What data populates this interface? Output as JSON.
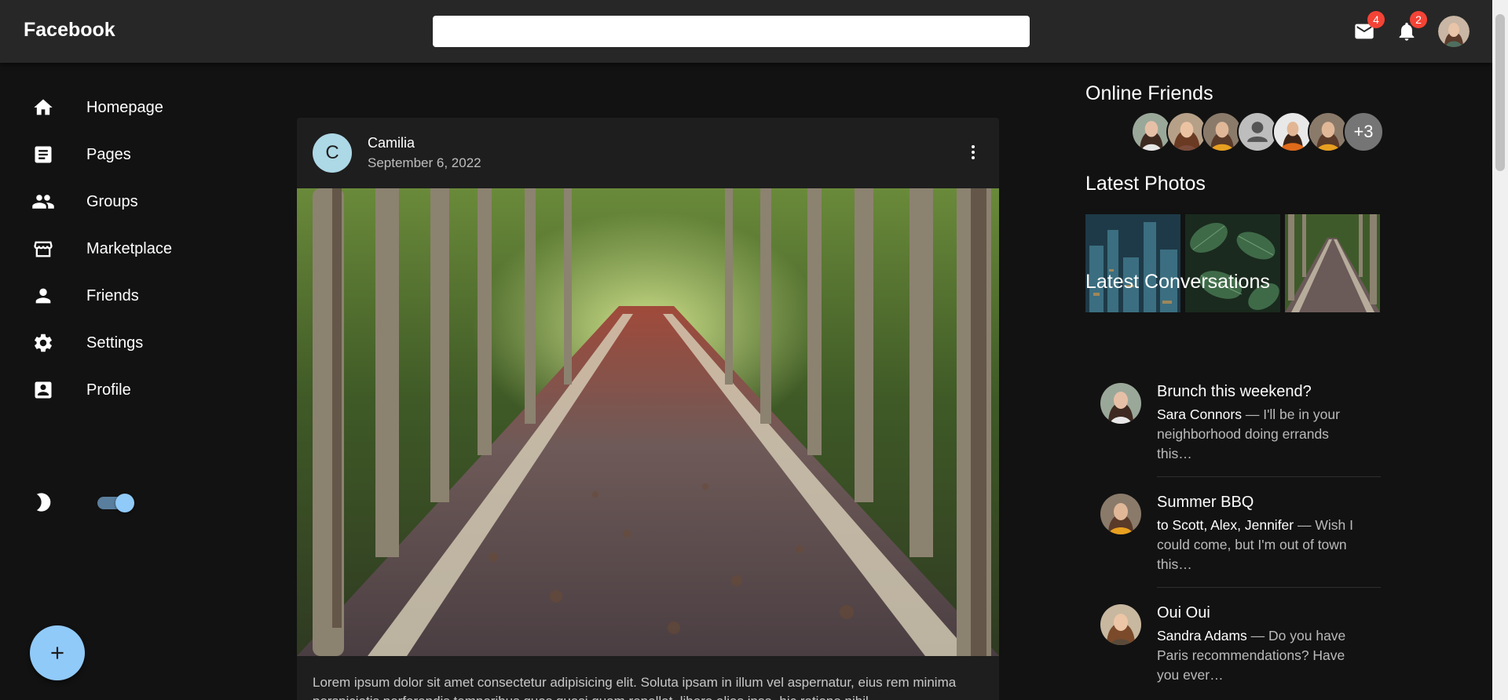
{
  "appbar": {
    "brand": "Facebook",
    "search_placeholder": "",
    "messages_badge": "4",
    "notifications_badge": "2"
  },
  "sidebar": {
    "items": [
      {
        "label": "Homepage",
        "icon": "home-icon"
      },
      {
        "label": "Pages",
        "icon": "article-icon"
      },
      {
        "label": "Groups",
        "icon": "people-icon"
      },
      {
        "label": "Marketplace",
        "icon": "storefront-icon"
      },
      {
        "label": "Friends",
        "icon": "person-icon"
      },
      {
        "label": "Settings",
        "icon": "gear-icon"
      },
      {
        "label": "Profile",
        "icon": "account-box-icon"
      }
    ],
    "dark_mode_on": true
  },
  "post": {
    "avatar_letter": "C",
    "author": "Camilia",
    "date": "September 6, 2022",
    "text": "Lorem ipsum dolor sit amet consectetur adipisicing elit. Soluta ipsam in illum vel aspernatur, eius rem minima perspiciatis perferendis temporibus quos quasi quam repellat, libero alias ipsa, hic ratione nihil."
  },
  "rightbar": {
    "online_title": "Online Friends",
    "online_more": "+3",
    "photos_title": "Latest Photos",
    "conversations_title": "Latest Conversations",
    "conversations": [
      {
        "title": "Brunch this weekend?",
        "who": "Sara Connors",
        "message": " — I'll be in your neighborhood doing errands this…"
      },
      {
        "title": "Summer BBQ",
        "who": "to Scott, Alex, Jennifer",
        "message": " — Wish I could come, but I'm out of town this…"
      },
      {
        "title": "Oui Oui",
        "who": "Sandra Adams",
        "message": " — Do you have Paris recommendations? Have you ever…"
      }
    ]
  },
  "colors": {
    "accent": "#90caf9",
    "badge": "#f44336",
    "appbar": "#272727",
    "background": "#121212"
  }
}
